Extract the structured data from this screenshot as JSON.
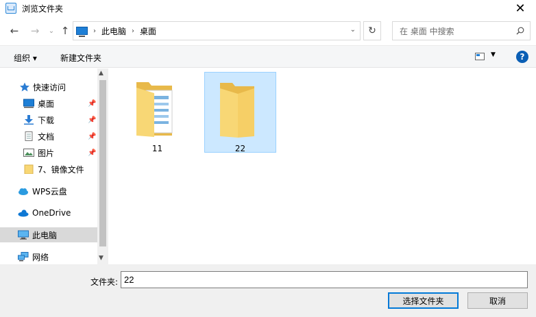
{
  "window": {
    "title": "浏览文件夹",
    "close_glyph": "✕"
  },
  "nav": {
    "back_glyph": "←",
    "forward_glyph": "→",
    "recent_glyph": "⌄",
    "up_glyph": "↑",
    "breadcrumb": [
      "此电脑",
      "桌面"
    ],
    "sep_glyph": "›",
    "refresh_glyph": "↻",
    "search_placeholder": "在 桌面 中搜索"
  },
  "toolbar": {
    "organize": "组织 ▾",
    "new_folder": "新建文件夹",
    "help": "?"
  },
  "sidebar": {
    "quick_access": "快速访问",
    "items": [
      {
        "label": "桌面",
        "pinned": true
      },
      {
        "label": "下载",
        "pinned": true
      },
      {
        "label": "文档",
        "pinned": true
      },
      {
        "label": "图片",
        "pinned": true
      },
      {
        "label": "7、镜像文件",
        "pinned": false
      }
    ],
    "wps": "WPS云盘",
    "onedrive": "OneDrive",
    "this_pc": "此电脑",
    "network": "网络"
  },
  "folders": [
    {
      "name": "11",
      "selected": false
    },
    {
      "name": "22",
      "selected": true
    }
  ],
  "footer": {
    "folder_label": "文件夹:",
    "folder_value": "22",
    "select_button": "选择文件夹",
    "cancel_button": "取消"
  },
  "colors": {
    "accent": "#0078d7",
    "selection": "#cce8ff",
    "folder": "#f8d775"
  }
}
